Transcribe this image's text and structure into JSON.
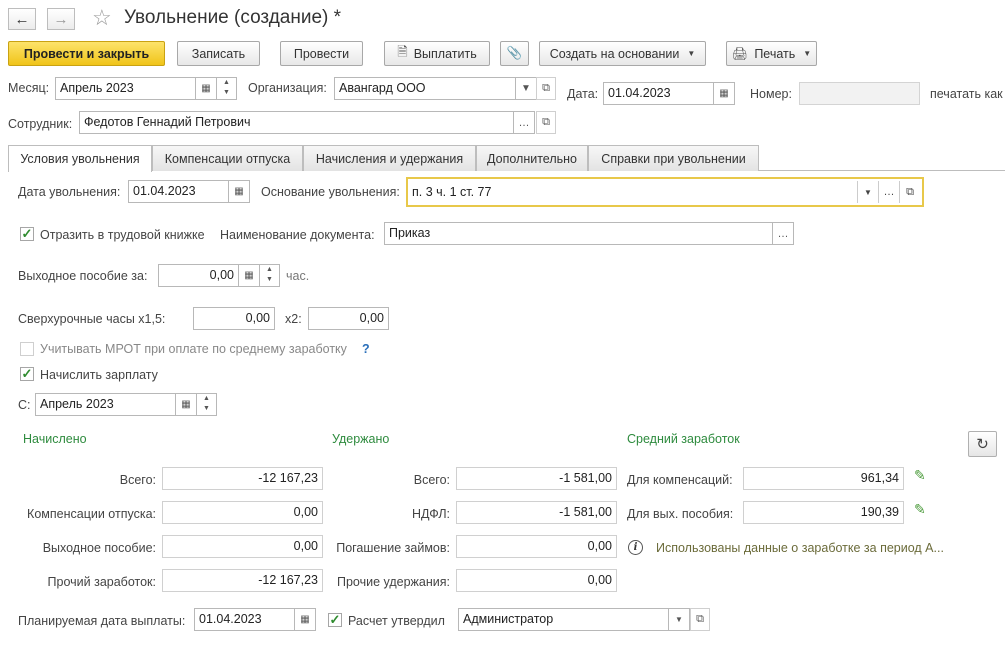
{
  "window": {
    "title": "Увольнение (создание) *"
  },
  "icons": {
    "back": "arrow-left",
    "forward": "arrow-right",
    "favorite": "star",
    "calendar": "calendar",
    "dropdown": "chevron-down",
    "open": "open-window",
    "pay": "document-pay",
    "attach": "paperclip",
    "print": "printer",
    "check": "checkmark",
    "edit": "pencil",
    "info": "info-circle",
    "refresh": "refresh"
  },
  "colors": {
    "primary_button": "#f5cf2f",
    "section_header": "#2e8b3e",
    "focus_border": "#e8c84a"
  },
  "toolbar": {
    "post_close": "Провести и закрыть",
    "save": "Записать",
    "post": "Провести",
    "pay": "Выплатить",
    "create_based": "Создать на основании",
    "print": "Печать"
  },
  "header": {
    "month_label": "Месяц:",
    "month_value": "Апрель 2023",
    "org_label": "Организация:",
    "org_value": "Авангард ООО",
    "date_label": "Дата:",
    "date_value": "01.04.2023",
    "number_label": "Номер:",
    "number_value": "",
    "print_as_label": "печатать как",
    "employee_label": "Сотрудник:",
    "employee_value": "Федотов Геннадий Петрович"
  },
  "tabs": [
    {
      "label": "Условия увольнения"
    },
    {
      "label": "Компенсации отпуска"
    },
    {
      "label": "Начисления и удержания"
    },
    {
      "label": "Дополнительно"
    },
    {
      "label": "Справки при увольнении"
    }
  ],
  "conditions": {
    "dismissal_date_label": "Дата увольнения:",
    "dismissal_date": "01.04.2023",
    "basis_label": "Основание увольнения:",
    "basis_value": "п. 3 ч. 1 ст. 77",
    "reflect_label": "Отразить в трудовой книжке",
    "reflect_checked": true,
    "doc_name_label": "Наименование документа:",
    "doc_name_value": "Приказ",
    "severance_label": "Выходное пособие за:",
    "severance_value": "0,00",
    "severance_unit": "час.",
    "overtime_label": "Сверхурочные часы х1,5:",
    "overtime_15": "0,00",
    "overtime_x2_label": "х2:",
    "overtime_2": "0,00",
    "mrot_label": "Учитывать МРОТ при оплате по среднему заработку",
    "mrot_checked": false,
    "mrot_help": "?",
    "accrue_label": "Начислить зарплату",
    "accrue_checked": true,
    "from_label": "С:",
    "from_value": "Апрель 2023"
  },
  "accrued": {
    "header": "Начислено",
    "total_label": "Всего:",
    "total": "-12 167,23",
    "vacation_label": "Компенсации отпуска:",
    "vacation": "0,00",
    "severance_label": "Выходное пособие:",
    "severance": "0,00",
    "other_label": "Прочий заработок:",
    "other": "-12 167,23"
  },
  "withheld": {
    "header": "Удержано",
    "total_label": "Всего:",
    "total": "-1 581,00",
    "ndfl_label": "НДФЛ:",
    "ndfl": "-1 581,00",
    "loans_label": "Погашение займов:",
    "loans": "0,00",
    "other_label": "Прочие удержания:",
    "other": "0,00"
  },
  "average": {
    "header": "Средний заработок",
    "comp_label": "Для компенсаций:",
    "comp": "961,34",
    "sev_label": "Для вых. пособия:",
    "sev": "190,39",
    "info_text": "Использованы данные о заработке за период А..."
  },
  "footer": {
    "pay_date_label": "Планируемая дата выплаты:",
    "pay_date": "01.04.2023",
    "approved_label": "Расчет утвердил",
    "approved_checked": true,
    "approver": "Администратор"
  }
}
